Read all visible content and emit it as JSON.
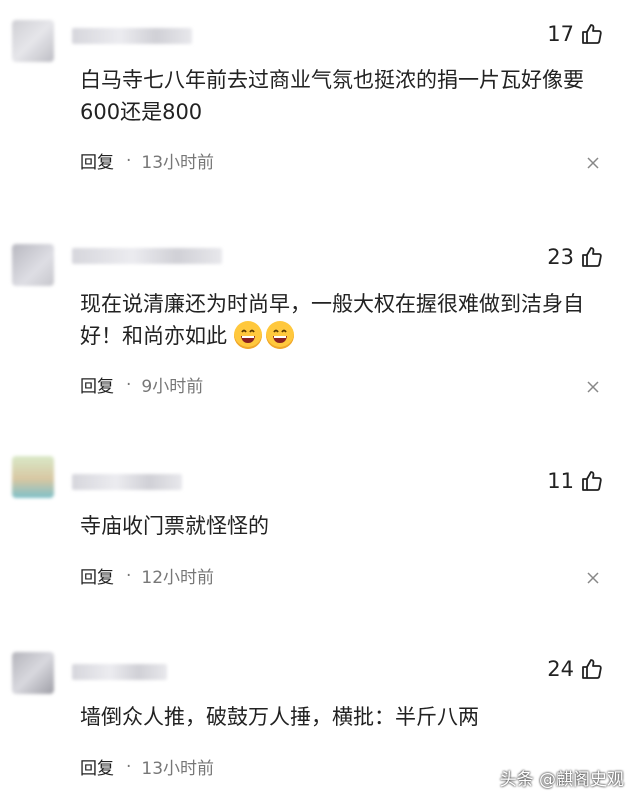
{
  "comments": [
    {
      "likes": "17",
      "text": "白马寺七八年前去过商业气氛也挺浓的捐一片瓦好像要600还是800",
      "reply": "回复",
      "time": "13小时前"
    },
    {
      "likes": "23",
      "text": "现在说清廉还为时尚早，一般大权在握很难做到洁身自好！和尚亦如此",
      "emoji_icons": [
        "grinning-face-icon",
        "grinning-face-icon"
      ],
      "reply": "回复",
      "time": "9小时前"
    },
    {
      "likes": "11",
      "text": "寺庙收门票就怪怪的",
      "reply": "回复",
      "time": "12小时前"
    },
    {
      "likes": "24",
      "text": "墙倒众人推，破鼓万人捶，横批：半斤八两",
      "reply": "回复",
      "time": "13小时前"
    }
  ],
  "watermark": "头条 @麒阁史观"
}
